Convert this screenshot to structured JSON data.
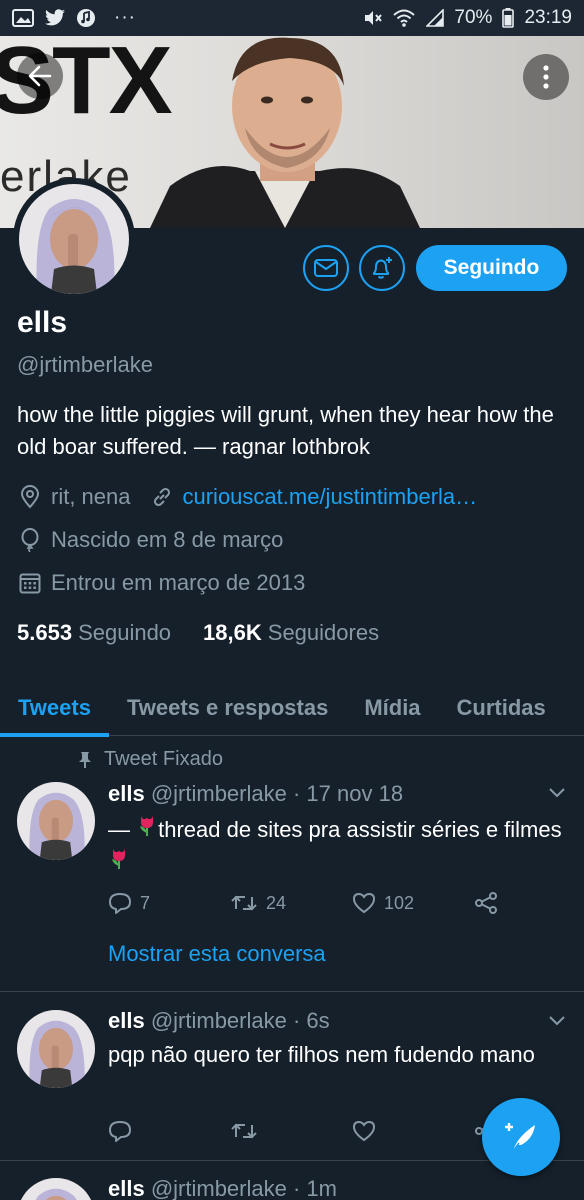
{
  "status_bar": {
    "battery": "70%",
    "time": "23:19",
    "more": "···"
  },
  "banner": {
    "text_large": "STX",
    "text_sub": "erlake"
  },
  "profile": {
    "follow_button": "Seguindo",
    "name": "ells",
    "handle": "@jrtimberlake",
    "bio": "how the little piggies will grunt, when they hear how the old boar suffered. — ragnar lothbrok",
    "location": "rit, nena",
    "link": "curiouscat.me/justintimberla…",
    "birthday": "Nascido em 8 de março",
    "joined": "Entrou em março de 2013",
    "following_count": "5.653",
    "following_label": "Seguindo",
    "followers_count": "18,6K",
    "followers_label": "Seguidores"
  },
  "tabs": [
    {
      "label": "Tweets",
      "active": true
    },
    {
      "label": "Tweets e respostas",
      "active": false
    },
    {
      "label": "Mídia",
      "active": false
    },
    {
      "label": "Curtidas",
      "active": false
    }
  ],
  "pinned_label": "Tweet Fixado",
  "tweets": [
    {
      "name": "ells",
      "handle": "@jrtimberlake",
      "time": "· 17 nov 18",
      "text_before": "— ",
      "text_middle": "thread de sites pra assistir séries e filmes ",
      "replies": "7",
      "retweets": "24",
      "likes": "102",
      "show_conversation": "Mostrar esta conversa"
    },
    {
      "name": "ells",
      "handle": "@jrtimberlake",
      "time": "· 6s",
      "text": "pqp não quero ter filhos nem fudendo mano"
    },
    {
      "name": "ells",
      "handle": "@jrtimberlake",
      "time": "· 1m"
    }
  ],
  "colors": {
    "background": "#15202b",
    "accent": "#1da1f2",
    "secondary_text": "#8899a6",
    "divider": "#38444d"
  }
}
